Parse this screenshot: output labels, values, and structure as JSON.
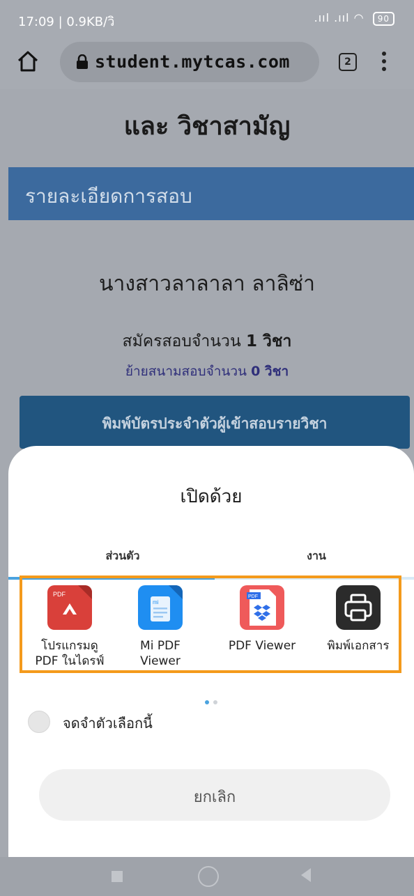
{
  "status_bar": {
    "left_text": "17:09 | 0.9KB/วิ",
    "signal_text": ".ııl .ııl",
    "battery": "90"
  },
  "browser": {
    "url": "student.mytcas.com",
    "tab_count": "2"
  },
  "page": {
    "subject_heading": "และ วิชาสามัญ",
    "section_header": "รายละเอียดการสอบ",
    "candidate_name": "นางสาวลาลาลา ลาลิซ่า",
    "subjects_prefix": "สมัครสอบจำนวน",
    "subjects_value": "1 วิชา",
    "moved_prefix": "ย้ายสนามสอบจำนวน",
    "moved_value": "0 วิชา",
    "print_card_button": "พิมพ์บัตรประจำตัวผู้เข้าสอบรายวิชา"
  },
  "sheet": {
    "title": "เปิดด้วย",
    "tabs": [
      {
        "label": "ส่วนตัว",
        "active": true
      },
      {
        "label": "งาน",
        "active": false
      }
    ],
    "apps": [
      {
        "label_line1": "โปรแกรมดู",
        "label_line2": "PDF ในไดรฟ์",
        "icon": "drive-pdf-icon",
        "badge": "PDF"
      },
      {
        "label_line1": "Mi PDF",
        "label_line2": "Viewer",
        "icon": "mi-pdf-icon",
        "badge": "mi"
      },
      {
        "label_line1": "PDF Viewer",
        "label_line2": "",
        "icon": "dropbox-pdf-icon",
        "badge": "PDF"
      },
      {
        "label_line1": "พิมพ์เอกสาร",
        "label_line2": "",
        "icon": "printer-icon"
      }
    ],
    "page_dots": {
      "count": 2,
      "active_index": 0
    },
    "remember_label": "จดจำตัวเลือกนี้",
    "cancel_label": "ยกเลิก"
  },
  "colors": {
    "highlight": "#f49a1c",
    "tab_indicator": "#4aa3df",
    "section_header_bg": "#3c6a9e",
    "print_button_bg": "#21557f"
  }
}
